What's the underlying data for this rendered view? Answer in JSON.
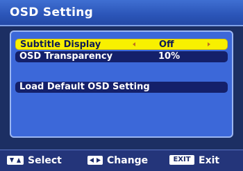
{
  "header": {
    "title": "OSD Setting"
  },
  "menu": {
    "items": [
      {
        "label": "Subtitle Display",
        "value": "Off"
      },
      {
        "label": "OSD Transparency",
        "value": "10%"
      },
      {
        "label": "Load Default OSD Setting",
        "value": ""
      }
    ]
  },
  "footer": {
    "select_label": "Select",
    "change_label": "Change",
    "exit_key": "EXIT",
    "exit_label": "Exit"
  },
  "colors": {
    "highlight": "#f8f000",
    "panel": "#3c68d9",
    "row": "#14206a"
  },
  "icons": [
    "up-down-arrows-icon",
    "left-right-arrows-icon",
    "left-arrow-icon",
    "right-arrow-icon"
  ]
}
